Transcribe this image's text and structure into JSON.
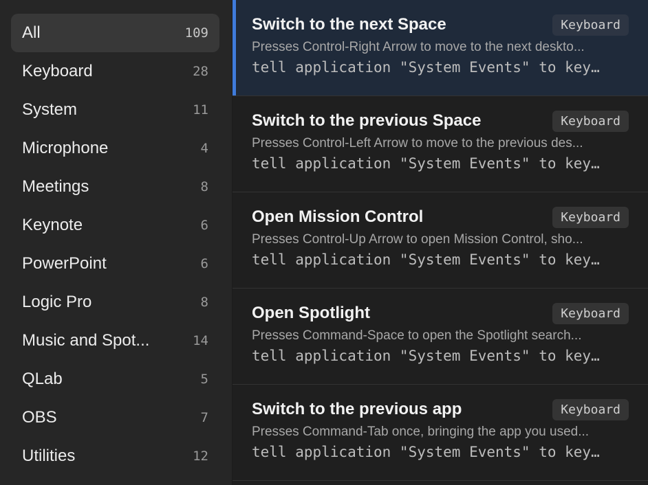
{
  "sidebar": {
    "categories": [
      {
        "label": "All",
        "count": "109",
        "active": true
      },
      {
        "label": "Keyboard",
        "count": "28"
      },
      {
        "label": "System",
        "count": "11"
      },
      {
        "label": "Microphone",
        "count": "4"
      },
      {
        "label": "Meetings",
        "count": "8"
      },
      {
        "label": "Keynote",
        "count": "6"
      },
      {
        "label": "PowerPoint",
        "count": "6"
      },
      {
        "label": "Logic Pro",
        "count": "8"
      },
      {
        "label": "Music and Spot...",
        "count": "14"
      },
      {
        "label": "QLab",
        "count": "5"
      },
      {
        "label": "OBS",
        "count": "7"
      },
      {
        "label": "Utilities",
        "count": "12"
      }
    ]
  },
  "list": {
    "items": [
      {
        "title": "Switch to the next Space",
        "tag": "Keyboard",
        "description": "Presses Control-Right Arrow to move to the next deskto...",
        "code": "tell application \"System Events\" to key…",
        "selected": true
      },
      {
        "title": "Switch to the previous Space",
        "tag": "Keyboard",
        "description": "Presses Control-Left Arrow to move to the previous des...",
        "code": "tell application \"System Events\" to key…"
      },
      {
        "title": "Open Mission Control",
        "tag": "Keyboard",
        "description": "Presses Control-Up Arrow to open Mission Control, sho...",
        "code": "tell application \"System Events\" to key…"
      },
      {
        "title": "Open Spotlight",
        "tag": "Keyboard",
        "description": "Presses Command-Space to open the Spotlight search...",
        "code": "tell application \"System Events\" to key…"
      },
      {
        "title": "Switch to the previous app",
        "tag": "Keyboard",
        "description": "Presses Command-Tab once, bringing the app you used...",
        "code": "tell application \"System Events\" to key…"
      }
    ]
  }
}
